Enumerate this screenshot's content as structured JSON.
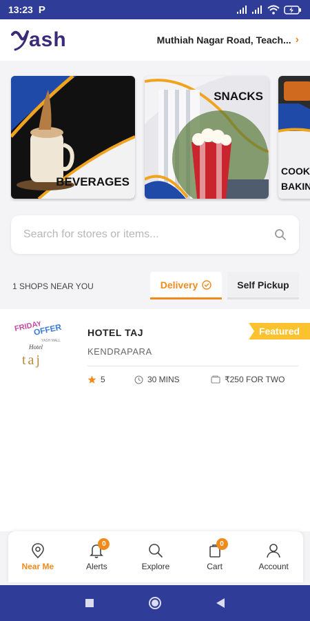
{
  "status_bar": {
    "time": "13:23",
    "notification": "P"
  },
  "header": {
    "logo_text": "ash",
    "location": "Muthiah Nagar Road, Teach..."
  },
  "banners": [
    {
      "label": "BEVERAGES"
    },
    {
      "label": "SNACKS"
    },
    {
      "label_line1": "COOKIN",
      "label_line2": "BAKING"
    }
  ],
  "search": {
    "placeholder": "Search for stores or items..."
  },
  "shops_bar": {
    "count": "1 SHOPS NEAR YOU",
    "tabs": [
      {
        "label": "Delivery",
        "active": true
      },
      {
        "label": "Self Pickup",
        "active": false
      }
    ]
  },
  "shops": [
    {
      "name": "HOTEL TAJ",
      "location": "KENDRAPARA",
      "badge": "Featured",
      "rating": "5",
      "time": "30 MINS",
      "price": "₹250 FOR TWO",
      "logo": {
        "line1": "FRIDAY",
        "line2": "OFFER",
        "line3": "YASH MALL",
        "line4": "Hotel",
        "line5": "taj"
      }
    }
  ],
  "bottom_nav": [
    {
      "label": "Near Me",
      "icon": "map-pin-icon",
      "active": true
    },
    {
      "label": "Alerts",
      "icon": "bell-icon",
      "badge": "0"
    },
    {
      "label": "Explore",
      "icon": "search-icon"
    },
    {
      "label": "Cart",
      "icon": "cart-icon",
      "badge": "0"
    },
    {
      "label": "Account",
      "icon": "user-icon"
    }
  ],
  "colors": {
    "primary": "#2f3d99",
    "accent": "#f08a1c",
    "featured": "#f9c22e",
    "logo": "#3b2a7a"
  }
}
